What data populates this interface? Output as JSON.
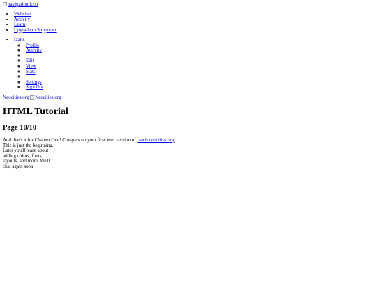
{
  "nav_toggle": {
    "icon_alt": "navigation icon",
    "icon": "navigation-icon"
  },
  "main_nav": {
    "items": [
      "Websites",
      "Activity",
      "Learn",
      "Upgrade to Supporter"
    ]
  },
  "account": {
    "username": "faaris",
    "items": [
      "Profile",
      "Activity",
      "",
      "Edit",
      "View",
      "Stats",
      "",
      "Settings",
      "Sign Out"
    ]
  },
  "logo": {
    "text_link": "Neocities.org",
    "image_alt": "Neocities.org"
  },
  "tutorial": {
    "title": "HTML Tutorial",
    "page_label": "Page 10/10",
    "intro_prefix": "And that's it for Chapter One! Congrats on your first ever version of ",
    "site_link": "faaris.neocities.org",
    "intro_suffix": "!",
    "lines": [
      "This is just the beginning.",
      "Later you'll learn about",
      "adding colors, fonts,",
      "layouts, and more. We'll",
      "chat again soon!"
    ]
  }
}
